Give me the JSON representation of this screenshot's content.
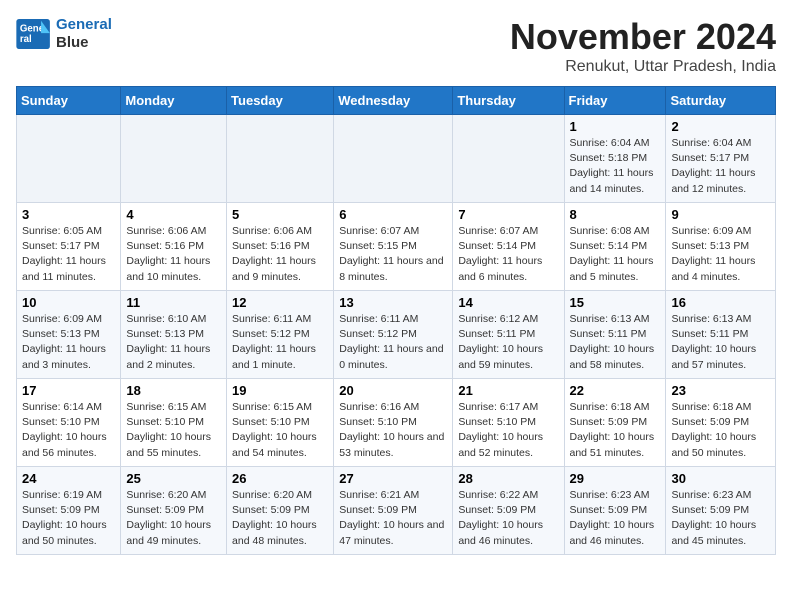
{
  "logo": {
    "line1": "General",
    "line2": "Blue"
  },
  "title": "November 2024",
  "location": "Renukut, Uttar Pradesh, India",
  "weekdays": [
    "Sunday",
    "Monday",
    "Tuesday",
    "Wednesday",
    "Thursday",
    "Friday",
    "Saturday"
  ],
  "weeks": [
    [
      {
        "day": "",
        "info": ""
      },
      {
        "day": "",
        "info": ""
      },
      {
        "day": "",
        "info": ""
      },
      {
        "day": "",
        "info": ""
      },
      {
        "day": "",
        "info": ""
      },
      {
        "day": "1",
        "info": "Sunrise: 6:04 AM\nSunset: 5:18 PM\nDaylight: 11 hours and 14 minutes."
      },
      {
        "day": "2",
        "info": "Sunrise: 6:04 AM\nSunset: 5:17 PM\nDaylight: 11 hours and 12 minutes."
      }
    ],
    [
      {
        "day": "3",
        "info": "Sunrise: 6:05 AM\nSunset: 5:17 PM\nDaylight: 11 hours and 11 minutes."
      },
      {
        "day": "4",
        "info": "Sunrise: 6:06 AM\nSunset: 5:16 PM\nDaylight: 11 hours and 10 minutes."
      },
      {
        "day": "5",
        "info": "Sunrise: 6:06 AM\nSunset: 5:16 PM\nDaylight: 11 hours and 9 minutes."
      },
      {
        "day": "6",
        "info": "Sunrise: 6:07 AM\nSunset: 5:15 PM\nDaylight: 11 hours and 8 minutes."
      },
      {
        "day": "7",
        "info": "Sunrise: 6:07 AM\nSunset: 5:14 PM\nDaylight: 11 hours and 6 minutes."
      },
      {
        "day": "8",
        "info": "Sunrise: 6:08 AM\nSunset: 5:14 PM\nDaylight: 11 hours and 5 minutes."
      },
      {
        "day": "9",
        "info": "Sunrise: 6:09 AM\nSunset: 5:13 PM\nDaylight: 11 hours and 4 minutes."
      }
    ],
    [
      {
        "day": "10",
        "info": "Sunrise: 6:09 AM\nSunset: 5:13 PM\nDaylight: 11 hours and 3 minutes."
      },
      {
        "day": "11",
        "info": "Sunrise: 6:10 AM\nSunset: 5:13 PM\nDaylight: 11 hours and 2 minutes."
      },
      {
        "day": "12",
        "info": "Sunrise: 6:11 AM\nSunset: 5:12 PM\nDaylight: 11 hours and 1 minute."
      },
      {
        "day": "13",
        "info": "Sunrise: 6:11 AM\nSunset: 5:12 PM\nDaylight: 11 hours and 0 minutes."
      },
      {
        "day": "14",
        "info": "Sunrise: 6:12 AM\nSunset: 5:11 PM\nDaylight: 10 hours and 59 minutes."
      },
      {
        "day": "15",
        "info": "Sunrise: 6:13 AM\nSunset: 5:11 PM\nDaylight: 10 hours and 58 minutes."
      },
      {
        "day": "16",
        "info": "Sunrise: 6:13 AM\nSunset: 5:11 PM\nDaylight: 10 hours and 57 minutes."
      }
    ],
    [
      {
        "day": "17",
        "info": "Sunrise: 6:14 AM\nSunset: 5:10 PM\nDaylight: 10 hours and 56 minutes."
      },
      {
        "day": "18",
        "info": "Sunrise: 6:15 AM\nSunset: 5:10 PM\nDaylight: 10 hours and 55 minutes."
      },
      {
        "day": "19",
        "info": "Sunrise: 6:15 AM\nSunset: 5:10 PM\nDaylight: 10 hours and 54 minutes."
      },
      {
        "day": "20",
        "info": "Sunrise: 6:16 AM\nSunset: 5:10 PM\nDaylight: 10 hours and 53 minutes."
      },
      {
        "day": "21",
        "info": "Sunrise: 6:17 AM\nSunset: 5:10 PM\nDaylight: 10 hours and 52 minutes."
      },
      {
        "day": "22",
        "info": "Sunrise: 6:18 AM\nSunset: 5:09 PM\nDaylight: 10 hours and 51 minutes."
      },
      {
        "day": "23",
        "info": "Sunrise: 6:18 AM\nSunset: 5:09 PM\nDaylight: 10 hours and 50 minutes."
      }
    ],
    [
      {
        "day": "24",
        "info": "Sunrise: 6:19 AM\nSunset: 5:09 PM\nDaylight: 10 hours and 50 minutes."
      },
      {
        "day": "25",
        "info": "Sunrise: 6:20 AM\nSunset: 5:09 PM\nDaylight: 10 hours and 49 minutes."
      },
      {
        "day": "26",
        "info": "Sunrise: 6:20 AM\nSunset: 5:09 PM\nDaylight: 10 hours and 48 minutes."
      },
      {
        "day": "27",
        "info": "Sunrise: 6:21 AM\nSunset: 5:09 PM\nDaylight: 10 hours and 47 minutes."
      },
      {
        "day": "28",
        "info": "Sunrise: 6:22 AM\nSunset: 5:09 PM\nDaylight: 10 hours and 46 minutes."
      },
      {
        "day": "29",
        "info": "Sunrise: 6:23 AM\nSunset: 5:09 PM\nDaylight: 10 hours and 46 minutes."
      },
      {
        "day": "30",
        "info": "Sunrise: 6:23 AM\nSunset: 5:09 PM\nDaylight: 10 hours and 45 minutes."
      }
    ]
  ]
}
